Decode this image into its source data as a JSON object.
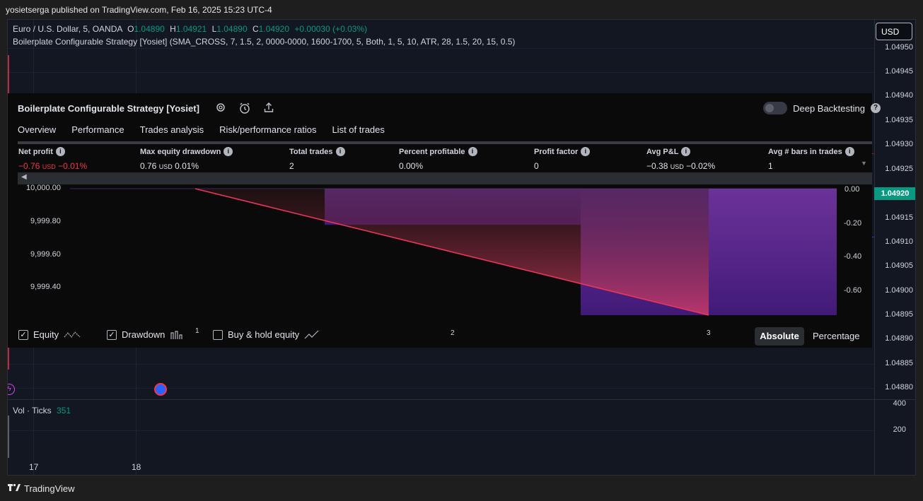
{
  "header": {
    "published": "yosietserga published on TradingView.com, Feb 16, 2025 15:23 UTC-4"
  },
  "legend": {
    "symbol": "Euro / U.S. Dollar, 5, OANDA",
    "o_label": "O",
    "o": "1.04890",
    "h_label": "H",
    "h": "1.04921",
    "l_label": "L",
    "l": "1.04890",
    "c_label": "C",
    "c": "1.04920",
    "change": "+0.00030 (+0.03%)",
    "strategy": "Boilerplate Configurable Strategy [Yosiet] (SMA_CROSS, 7, 1.5, 2, 0000-0000, 1600-1700, 5, Both, 1, 5, 10, ATR, 28, 1.5, 20, 15, 0.5)"
  },
  "currency_button": "USD",
  "price_scale": [
    "1.04950",
    "1.04945",
    "1.04940",
    "1.04935",
    "1.04930",
    "1.04925",
    "1.04920",
    "1.04915",
    "1.04910",
    "1.04905",
    "1.04900",
    "1.04895",
    "1.04890",
    "1.04885",
    "1.04880"
  ],
  "last_price": "1.04920",
  "volume_scale": [
    "400",
    "200"
  ],
  "volume": {
    "label": "Vol · Ticks",
    "value": "351"
  },
  "time_axis": [
    "17",
    "18"
  ],
  "panel": {
    "title": "Boilerplate Configurable Strategy [Yosiet]",
    "deep_backtesting": "Deep Backtesting",
    "help": "?",
    "tabs": [
      "Overview",
      "Performance",
      "Trades analysis",
      "Risk/performance ratios",
      "List of trades"
    ],
    "metrics": [
      {
        "header": "Net profit",
        "value": "−0.76",
        "unit": "USD",
        "pct": "−0.01%",
        "negative": true
      },
      {
        "header": "Max equity drawdown",
        "value": "0.76",
        "unit": "USD",
        "pct": "0.01%",
        "negative": false
      },
      {
        "header": "Total trades",
        "value": "2",
        "unit": "",
        "pct": "",
        "negative": false
      },
      {
        "header": "Percent profitable",
        "value": "0.00%",
        "unit": "",
        "pct": "",
        "negative": false
      },
      {
        "header": "Profit factor",
        "value": "0",
        "unit": "",
        "pct": "",
        "negative": false
      },
      {
        "header": "Avg P&L",
        "value": "−0.38",
        "unit": "USD",
        "pct": "−0.02%",
        "negative": false
      },
      {
        "header": "Avg # bars in trades",
        "value": "1",
        "unit": "",
        "pct": "",
        "negative": false
      }
    ],
    "equity_axis": [
      "10,000.00",
      "9,999.80",
      "9,999.60",
      "9,999.40"
    ],
    "drawdown_axis": [
      "0.00",
      "-0.20",
      "-0.40",
      "-0.60"
    ],
    "trade_numbers": [
      "1",
      "2",
      "3"
    ],
    "checkbox_equity": "Equity",
    "checkbox_drawdown": "Drawdown",
    "checkbox_buyhold": "Buy & hold equity",
    "equity_checked": true,
    "drawdown_checked": true,
    "buyhold_checked": false,
    "absolute": "Absolute",
    "percentage": "Percentage"
  },
  "equity_chart": {
    "equity_start": 10000.0,
    "equity_end": 9999.24,
    "drawdown": [
      {
        "trade": 1,
        "value": -0.2
      },
      {
        "trade": 2,
        "value": -0.7
      },
      {
        "trade": 3,
        "value": -0.7
      }
    ]
  },
  "brand": "TradingView",
  "colors": {
    "up": "#089981",
    "down": "#f23645",
    "panel_bg": "#0a0a0b",
    "chart_bg": "#131722",
    "drawdown_fill": "#6a2aa8"
  }
}
